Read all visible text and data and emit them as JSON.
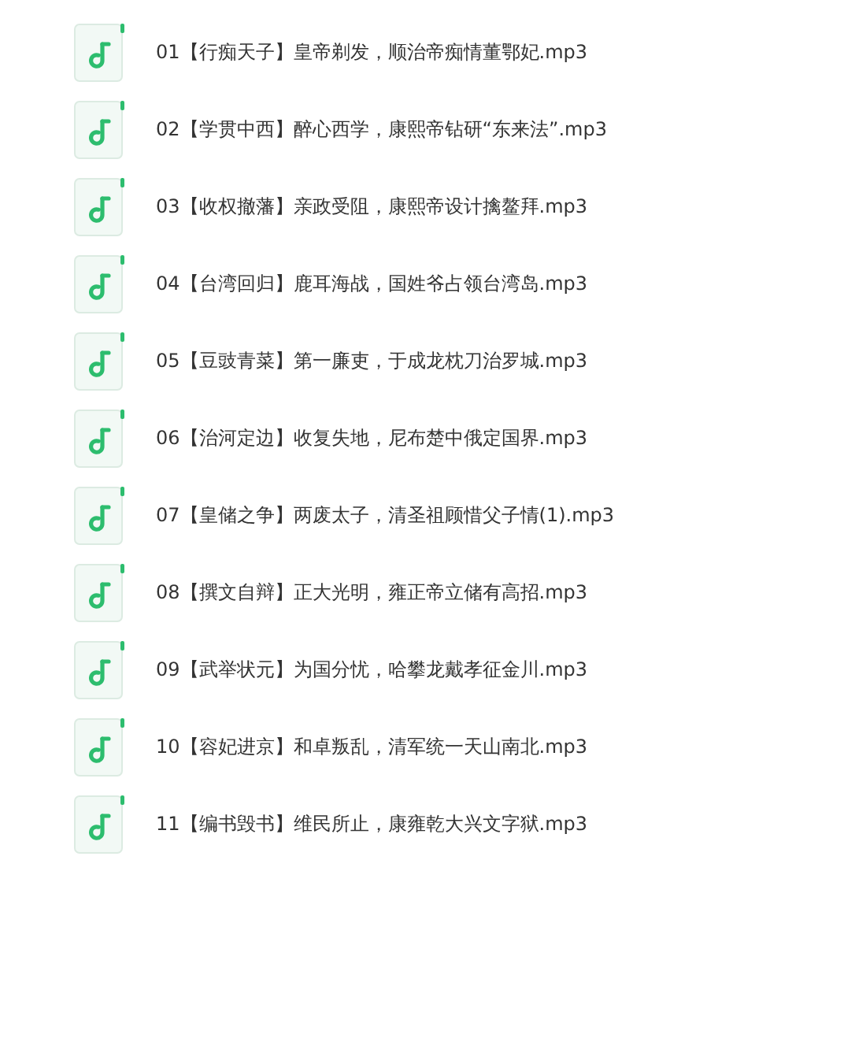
{
  "files": [
    {
      "name": "01【行痴天子】皇帝剃发，顺治帝痴情董鄂妃.mp3"
    },
    {
      "name": "02【学贯中西】醉心西学，康熙帝钻研“东来法”.mp3"
    },
    {
      "name": "03【收权撤藩】亲政受阻，康熙帝设计擒鳌拜.mp3"
    },
    {
      "name": "04【台湾回归】鹿耳海战，国姓爷占领台湾岛.mp3"
    },
    {
      "name": "05【豆豉青菜】第一廉吏，于成龙枕刀治罗城.mp3"
    },
    {
      "name": "06【治河定边】收复失地，尼布楚中俄定国界.mp3"
    },
    {
      "name": "07【皇储之争】两废太子，清圣祖顾惜父子情(1).mp3"
    },
    {
      "name": "08【撰文自辩】正大光明，雍正帝立储有高招.mp3"
    },
    {
      "name": "09【武举状元】为国分忧，哈攀龙戴孝征金川.mp3"
    },
    {
      "name": "10【容妃进京】和卓叛乱，清军统一天山南北.mp3"
    },
    {
      "name": "11【编书毁书】维民所止，康雍乾大兴文字狱.mp3"
    }
  ]
}
